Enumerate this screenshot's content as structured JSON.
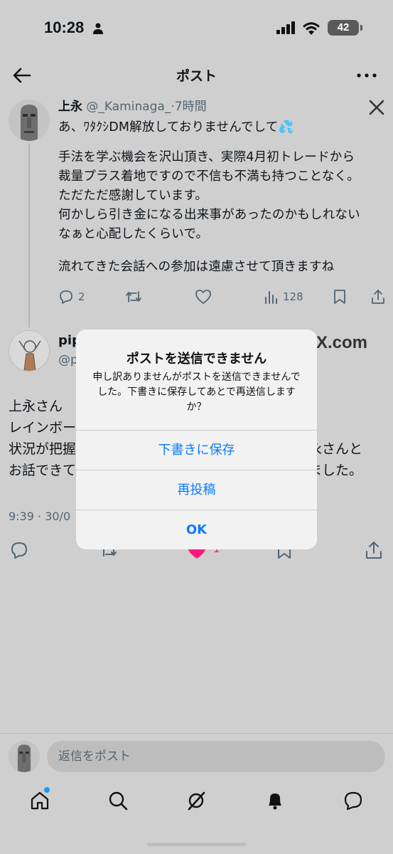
{
  "status": {
    "time": "10:28",
    "battery": "42"
  },
  "nav": {
    "title": "ポスト"
  },
  "tweet1": {
    "name": "上永",
    "handle": "@_Kaminaga_",
    "time": "·7時間",
    "line1": "あ、ﾜﾀｸｼDM解放しておりませんでして💦",
    "body": "手法を学ぶ機会を沢山頂き、実際4月初トレードから\n裁量プラス着地ですので不信も不満も持つことなく。\nただただ感謝しています。\n何かしら引き金になる出来事があったのかもしれない\nなぁと心配したくらいで。",
    "line_last": "流れてきた会話への参加は遠慮させて頂きますね",
    "replies": "2",
    "views": "128"
  },
  "tweet2": {
    "name": "pip",
    "handle": "@p",
    "xcom": "X.com",
    "lines": [
      {
        "left": "上永さん ",
        "right": ""
      },
      {
        "left": "レインボー",
        "right": ""
      },
      {
        "left": "状況が把握",
        "right": "永さんと"
      },
      {
        "left": "お話できて",
        "right": "ました。"
      }
    ],
    "date": "9:39 · 30/0",
    "likes": "1"
  },
  "reply": {
    "placeholder": "返信をポスト"
  },
  "alert": {
    "title": "ポストを送信できません",
    "message": "申し訳ありませんがポストを送信できませんでした。下書きに保存してあとで再送信しますか？",
    "buttons": [
      "下書きに保存",
      "再投稿",
      "OK"
    ]
  },
  "colors": {
    "accent": "#0a7cff",
    "like": "#f91880",
    "dim_background": "#cfcfcf"
  },
  "icons": [
    "back-arrow-icon",
    "more-icon",
    "x-logo-icon",
    "reply-icon",
    "repost-icon",
    "like-icon",
    "views-icon",
    "bookmark-icon",
    "share-icon",
    "home-icon",
    "search-icon",
    "grok-icon",
    "bell-icon",
    "messages-icon"
  ]
}
